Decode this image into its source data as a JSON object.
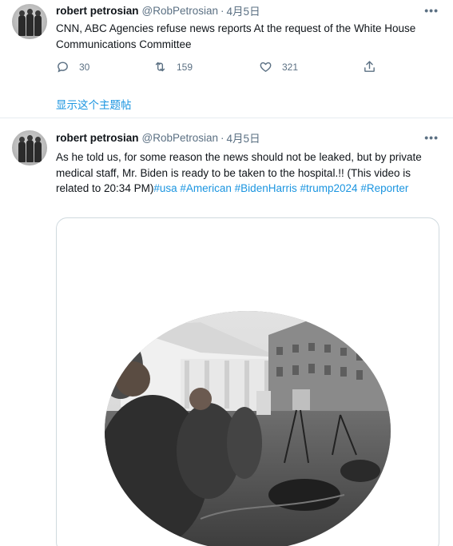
{
  "tweets": [
    {
      "author": {
        "name": "robert petrosian",
        "handle": "@RobPetrosian"
      },
      "separator": "·",
      "date": "4月5日",
      "text": "CNN, ABC Agencies refuse news reports At the request of the White House Communications Committee",
      "actions": {
        "replies": "30",
        "retweets": "159",
        "likes": "321"
      },
      "show_thread": "显示这个主题帖"
    },
    {
      "author": {
        "name": "robert petrosian",
        "handle": "@RobPetrosian"
      },
      "separator": "·",
      "date": "4月5日",
      "text_plain": "As he told us, for some reason the news should not be leaked, but by private medical staff, Mr. Biden is ready to be taken to the hospital.!! (This video is related to 20:34 PM)",
      "hashtags": [
        "#usa",
        "#American",
        "#BidenHarris",
        "#trump2024",
        "#Reporter"
      ]
    }
  ],
  "icons": {
    "more": "more-icon",
    "reply": "reply-icon",
    "retweet": "retweet-icon",
    "like": "like-icon",
    "share": "share-icon"
  },
  "colors": {
    "link": "#1b95e0",
    "secondary_text": "#5b7083",
    "primary_text": "#0f1419",
    "divider": "#e6ecf0"
  }
}
